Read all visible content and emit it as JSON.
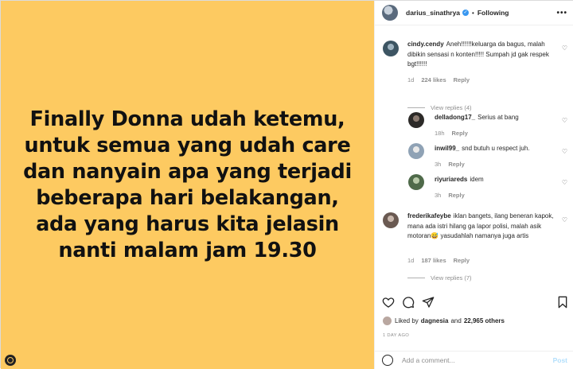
{
  "post": {
    "lines": [
      "Finally Donna udah ketemu,",
      "untuk semua yang udah care",
      "dan nanyain apa yang terjadi",
      "beberapa hari belakangan,",
      "ada yang harus kita jelasin",
      "nanti malam jam 19.30"
    ],
    "background_color": "#fdca61"
  },
  "header": {
    "username": "darius_sinathrya",
    "separator": "•",
    "follow_label": "Following",
    "more": "•••"
  },
  "comments": [
    {
      "user": "cindy.cendy",
      "text": "Aneh!!!!!!keluarga da bagus, malah dibikin sensasi n konten!!!!! Sumpah jd gak respek bgt!!!!!!",
      "age": "1d",
      "likes": "224 likes",
      "reply": "Reply",
      "view_replies": "View replies (4)"
    },
    {
      "user": "delladong17_",
      "text": "Serius at bang",
      "age": "18h",
      "reply": "Reply"
    },
    {
      "user": "inwil99_",
      "text": "snd butuh u respect juh.",
      "age": "3h",
      "reply": "Reply"
    },
    {
      "user": "riyuriareds",
      "text": "idem",
      "age": "3h",
      "reply": "Reply"
    },
    {
      "user": "frederikafeybe",
      "text": "iklan bangets, ilang beneran kapok, mana ada istri hilang ga lapor polisi, malah asik motoran😅 yasudahlah namanya juga artis",
      "age": "1d",
      "likes": "187 likes",
      "reply": "Reply",
      "view_replies": "View replies (7)"
    }
  ],
  "likes": {
    "prefix": "Liked by",
    "user": "dagnesia",
    "and": "and",
    "others": "22,965 others"
  },
  "time_ago": "1 DAY AGO",
  "add_comment": {
    "placeholder": "Add a comment...",
    "post_label": "Post"
  },
  "icons": [
    "heart-icon",
    "comment-icon",
    "share-icon",
    "bookmark-icon",
    "emoji-icon",
    "verified-icon"
  ]
}
